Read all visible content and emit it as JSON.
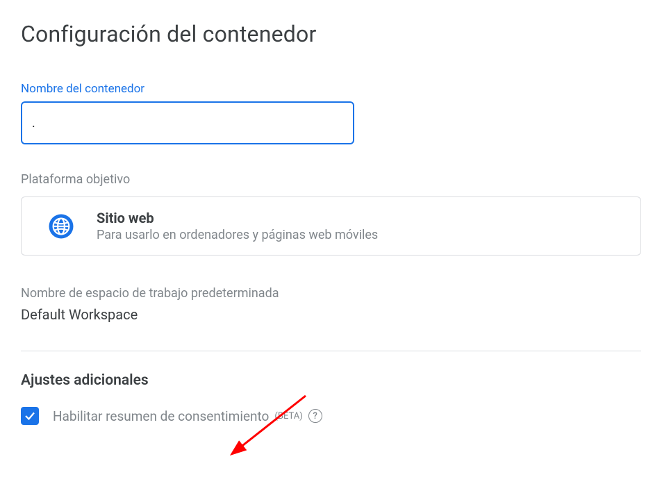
{
  "title": "Configuración del contenedor",
  "containerName": {
    "label": "Nombre del contenedor",
    "value": "."
  },
  "platform": {
    "sectionLabel": "Plataforma objetivo",
    "title": "Sitio web",
    "description": "Para usarlo en ordenadores y páginas web móviles"
  },
  "workspace": {
    "label": "Nombre de espacio de trabajo predeterminada",
    "value": "Default Workspace"
  },
  "additional": {
    "title": "Ajustes adicionales",
    "consent": {
      "label": "Habilitar resumen de consentimiento",
      "badge": "(BETA)",
      "checked": true
    }
  }
}
